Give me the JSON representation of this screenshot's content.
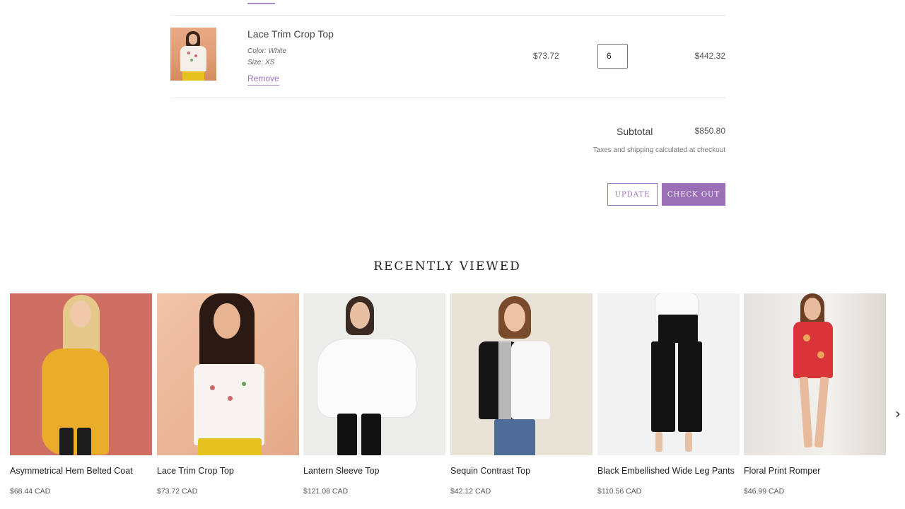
{
  "cart": {
    "item": {
      "title": "Lace Trim Crop Top",
      "color": "Color: White",
      "size": "Size: XS",
      "remove_label": "Remove",
      "price": "$73.72",
      "quantity": "6",
      "line_total": "$442.32"
    },
    "subtotal_label": "Subtotal",
    "subtotal_value": "$850.80",
    "tax_note": "Taxes and shipping calculated at checkout",
    "update_label": "UPDATE",
    "checkout_label": "CHECK OUT"
  },
  "recently_viewed": {
    "heading": "RECENTLY VIEWED",
    "products": [
      {
        "name": "Asymmetrical Hem Belted Coat",
        "price": "$68.44 CAD"
      },
      {
        "name": "Lace Trim Crop Top",
        "price": "$73.72 CAD"
      },
      {
        "name": "Lantern Sleeve Top",
        "price": "$121.08 CAD"
      },
      {
        "name": "Sequin Contrast Top",
        "price": "$42.12 CAD"
      },
      {
        "name": "Black Embellished Wide Leg Pants",
        "price": "$110.56 CAD"
      },
      {
        "name": "Floral Print Romper",
        "price": "$46.99 CAD"
      }
    ],
    "next_icon": "chevron-right-icon"
  },
  "colors": {
    "accent": "#9a6fb6",
    "accent_light": "#a98ac4"
  }
}
